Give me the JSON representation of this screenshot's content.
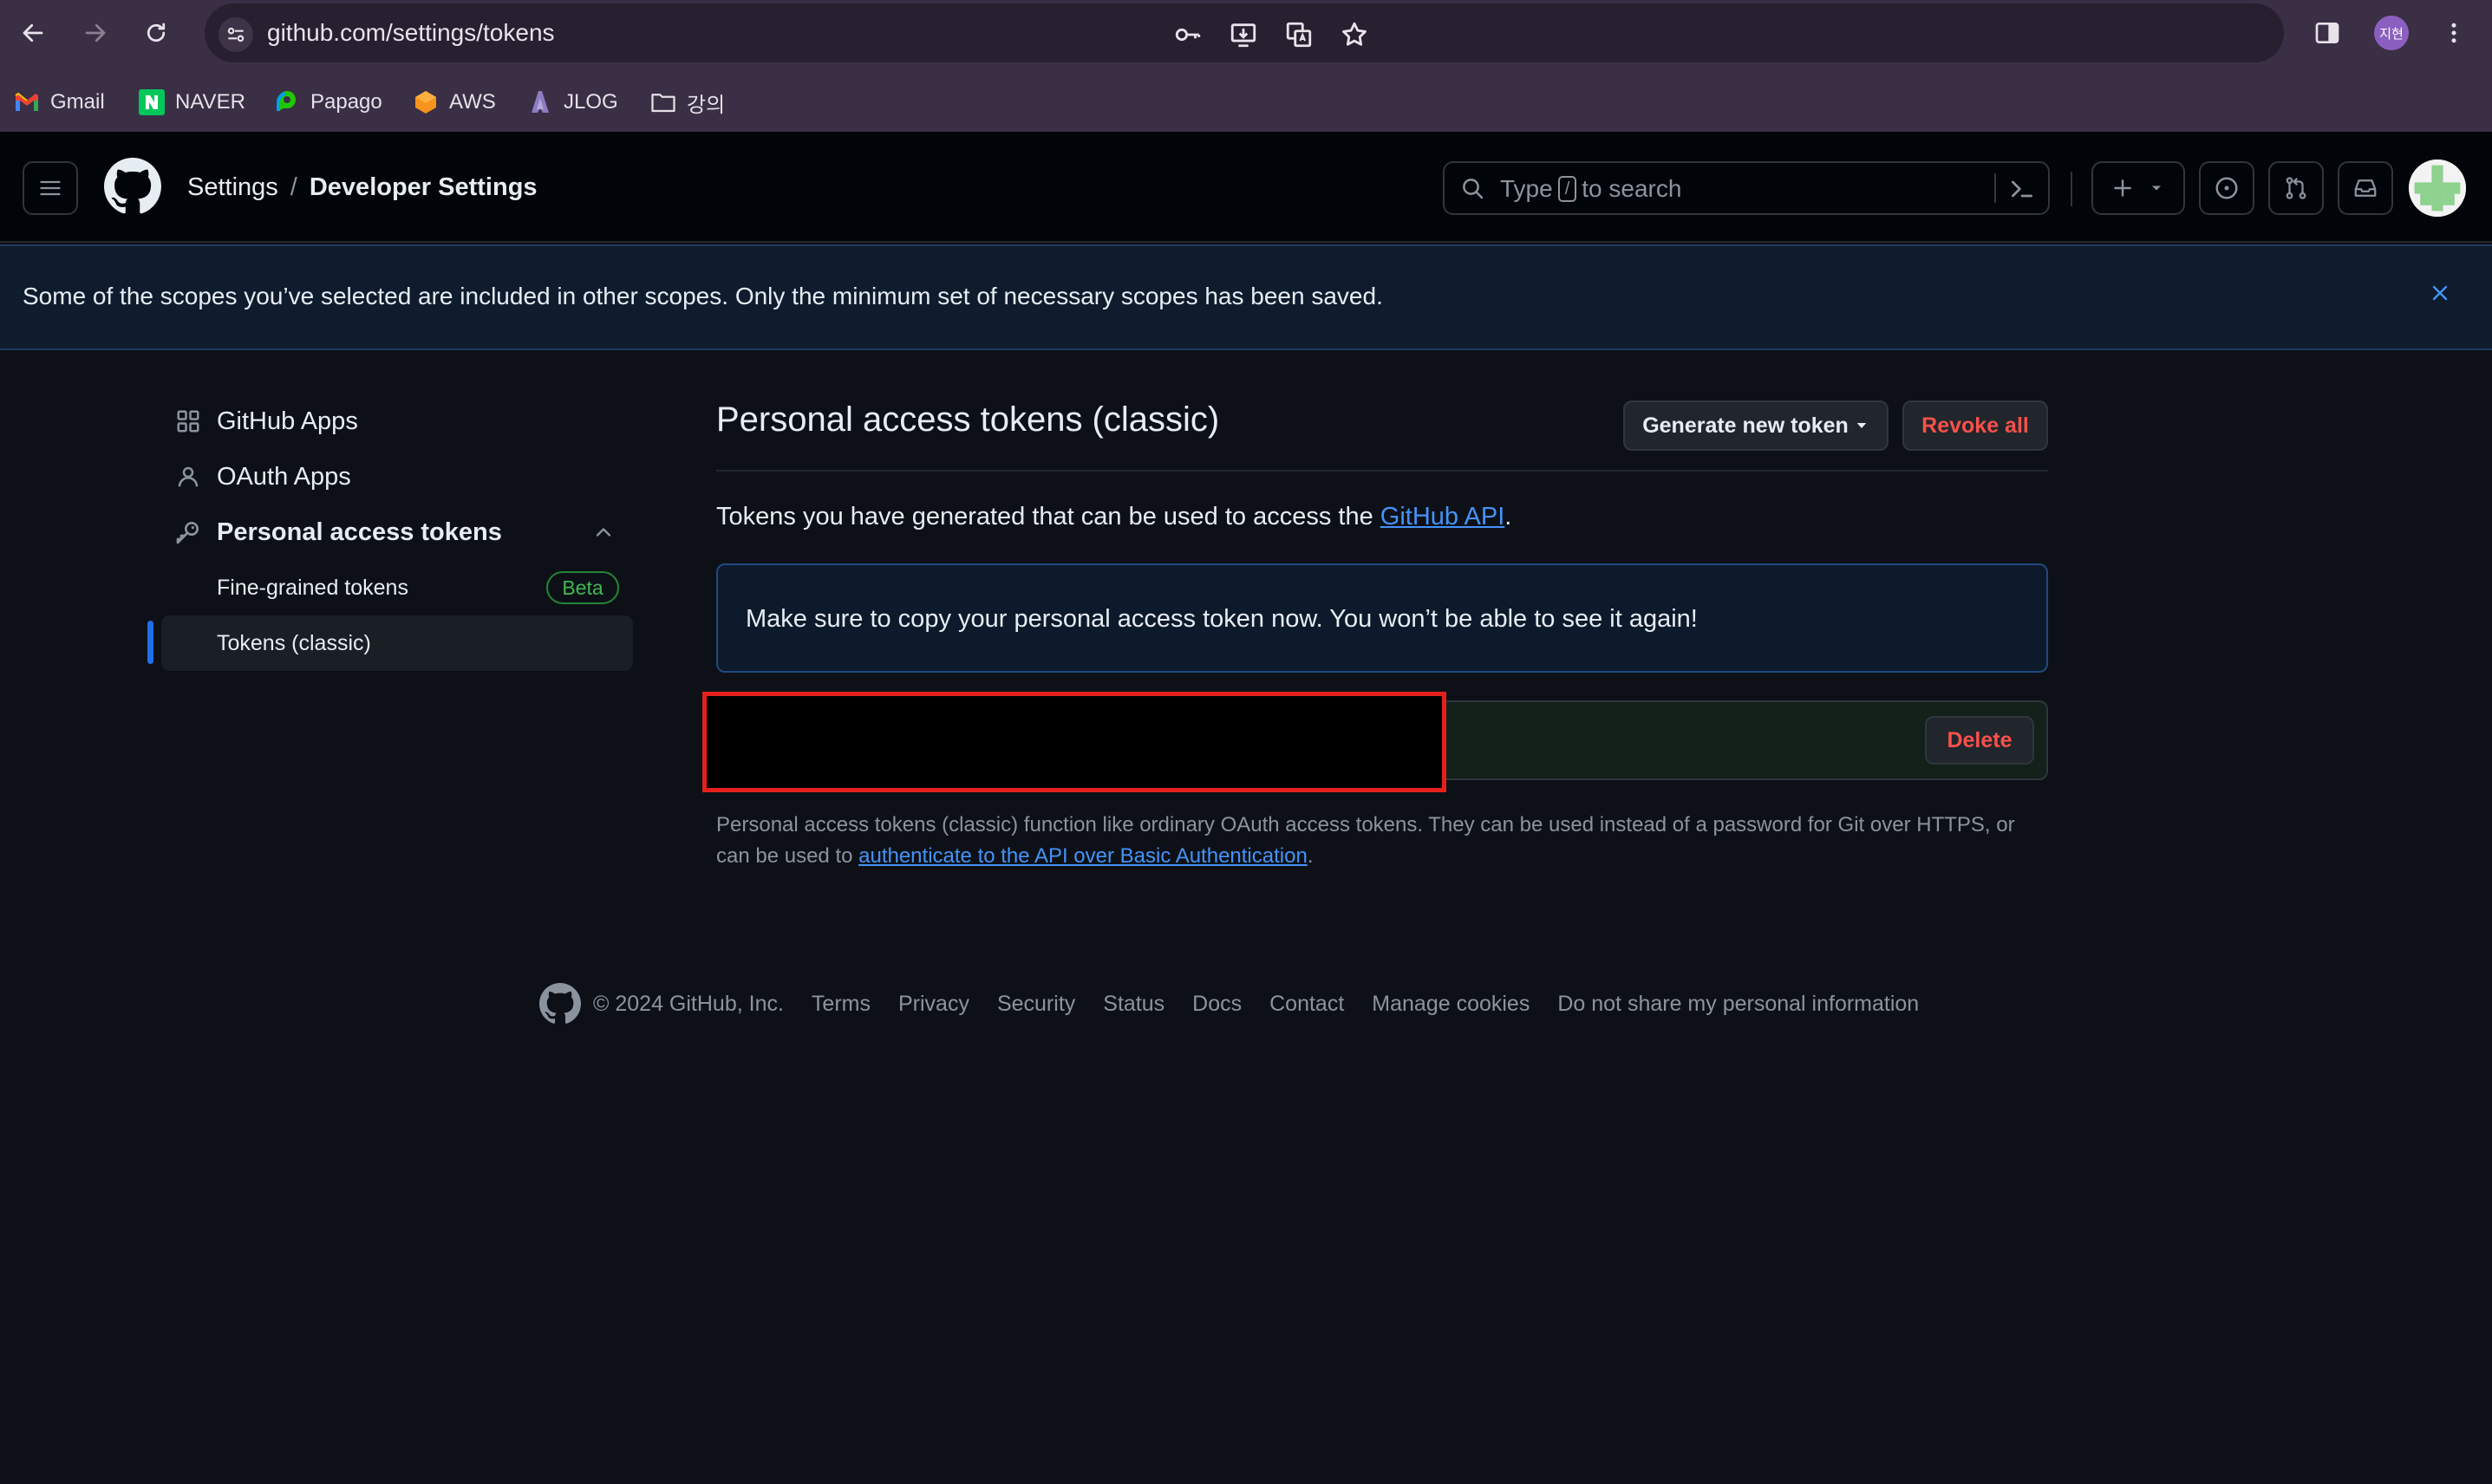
{
  "browser": {
    "url": "github.com/settings/tokens",
    "profile_initials": "지현",
    "bookmarks": [
      {
        "label": "Gmail",
        "icon": "gmail-icon"
      },
      {
        "label": "NAVER",
        "icon": "naver-icon"
      },
      {
        "label": "Papago",
        "icon": "papago-icon"
      },
      {
        "label": "AWS",
        "icon": "aws-icon"
      },
      {
        "label": "JLOG",
        "icon": "jlog-icon"
      },
      {
        "label": "강의",
        "icon": "folder-icon"
      }
    ]
  },
  "header": {
    "breadcrumb_root": "Settings",
    "breadcrumb_sep": "/",
    "breadcrumb_current": "Developer Settings",
    "search_prefix": "Type",
    "search_key": "/",
    "search_suffix": "to search"
  },
  "flash": {
    "message": "Some of the scopes you’ve selected are included in other scopes. Only the minimum set of necessary scopes has been saved."
  },
  "sidebar": {
    "items": [
      {
        "label": "GitHub Apps",
        "icon": "apps-grid-icon"
      },
      {
        "label": "OAuth Apps",
        "icon": "person-icon"
      },
      {
        "label": "Personal access tokens",
        "icon": "key-icon"
      }
    ],
    "sub_items": [
      {
        "label": "Fine-grained tokens",
        "badge": "Beta"
      },
      {
        "label": "Tokens (classic)",
        "active": true
      }
    ]
  },
  "main": {
    "title": "Personal access tokens (classic)",
    "generate_button": "Generate new token",
    "revoke_button": "Revoke all",
    "intro_text": "Tokens you have generated that can be used to access the ",
    "intro_link": "GitHub API",
    "intro_end": ".",
    "notice": "Make sure to copy your personal access token now. You won’t be able to see it again!",
    "delete_button": "Delete",
    "help_text": "Personal access tokens (classic) function like ordinary OAuth access tokens. They can be used instead of a password for Git over HTTPS, or can be used to ",
    "help_link": "authenticate to the API over Basic Authentication",
    "help_end": "."
  },
  "footer": {
    "copyright": "© 2024 GitHub, Inc.",
    "links": [
      "Terms",
      "Privacy",
      "Security",
      "Status",
      "Docs",
      "Contact",
      "Manage cookies",
      "Do not share my personal information"
    ]
  },
  "colors": {
    "accent_link": "#4493f8",
    "danger": "#f85149",
    "success": "#3fb950",
    "redaction_border": "#e5201c"
  }
}
